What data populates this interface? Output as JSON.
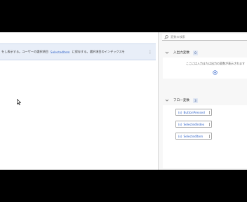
{
  "canvas": {
    "action_text_before": "をし表示する。ユーザーの選択項目",
    "action_var": "SelectedItem",
    "action_text_after": "に保存する。選択項目のインデックスを",
    "more_label": "⋮"
  },
  "pane": {
    "search_placeholder": "変数の検索",
    "io_section": {
      "title": "入出力変数",
      "count": "0",
      "empty_text": "ここには入力または出力の変数が表示されます"
    },
    "flow_section": {
      "title": "フロー変数",
      "count": "3",
      "items": [
        {
          "prefix": "(x)",
          "name": "ButtonPressed"
        },
        {
          "prefix": "(x)",
          "name": "SelectedIndex"
        },
        {
          "prefix": "(x)",
          "name": "SelectedItem"
        }
      ]
    }
  },
  "colors": {
    "accent": "#2f62c9",
    "action_row_bg": "#e8eef8",
    "badge_bg": "#dfe6f3"
  },
  "icons": [
    "search-icon",
    "chevron-down-icon",
    "add-variable-icon",
    "mouse-cursor-icon"
  ]
}
